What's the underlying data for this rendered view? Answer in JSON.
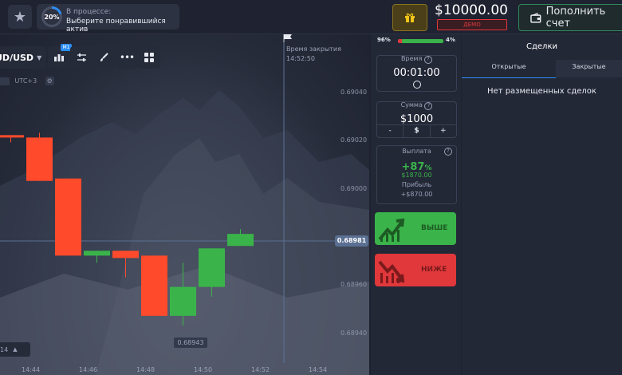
{
  "topbar": {
    "progress_percent": "20%",
    "progress_title": "В процессе:",
    "progress_subtitle": "Выберите понравившийся актив",
    "balance": "$10000.00",
    "account_type": "ДЕМО",
    "topup_label": "Пополнить счет",
    "colors": {
      "accent_blue": "#2d8ef5",
      "demo_red": "#e0383b",
      "topup_border": "#2f8a5a",
      "gift_gold": "#8a7420"
    }
  },
  "chart": {
    "pair": "UD/USD",
    "timeframe_badge": "M1",
    "timezone": "UTC+3",
    "closing_label": "Время закрытия",
    "closing_time": "14:52:50",
    "price_axis": [
      "0.69040",
      "0.69020",
      "0.69000",
      "0.68960",
      "0.68940"
    ],
    "current_price": "0.68981",
    "min_price": "0.68943",
    "time_axis": [
      "14:44",
      "14:46",
      "14:48",
      "14:50",
      "14:52",
      "14:54"
    ],
    "zoom_label": "14",
    "candles": [
      {
        "open": 0.69022,
        "close": 0.69021,
        "high": 0.69022,
        "low": 0.69019,
        "dir": "down"
      },
      {
        "open": 0.69021,
        "close": 0.69003,
        "high": 0.69023,
        "low": 0.69003,
        "dir": "down"
      },
      {
        "open": 0.69004,
        "close": 0.68972,
        "high": 0.69004,
        "low": 0.68972,
        "dir": "down"
      },
      {
        "open": 0.68974,
        "close": 0.68972,
        "high": 0.68974,
        "low": 0.68969,
        "dir": "up"
      },
      {
        "open": 0.68974,
        "close": 0.68971,
        "high": 0.68974,
        "low": 0.68963,
        "dir": "down"
      },
      {
        "open": 0.68972,
        "close": 0.68947,
        "high": 0.68972,
        "low": 0.68947,
        "dir": "down"
      },
      {
        "open": 0.68947,
        "close": 0.68959,
        "high": 0.68969,
        "low": 0.68943,
        "dir": "up"
      },
      {
        "open": 0.68959,
        "close": 0.68975,
        "high": 0.68975,
        "low": 0.68955,
        "dir": "up"
      },
      {
        "open": 0.68976,
        "close": 0.68981,
        "high": 0.68983,
        "low": 0.68976,
        "dir": "up"
      }
    ],
    "colors": {
      "up": "#3ab44a",
      "down": "#ff4a2b",
      "price_line": "#5a6f92"
    }
  },
  "trade": {
    "sell_percent": "96%",
    "buy_percent": "4%",
    "time_label": "Время",
    "time_value": "00:01:00",
    "amount_label": "Сумма",
    "amount_value": "$1000",
    "minus": "-",
    "currency": "$",
    "plus": "+",
    "payout_label": "Выплата",
    "payout_percent": "+87",
    "payout_percent_sign": "%",
    "payout_amount": "$1870.00",
    "profit_label": "Прибыль",
    "profit_amount": "+$870.00",
    "up_label": "ВЫШЕ",
    "down_label": "НИЖЕ",
    "colors": {
      "up": "#3ab44a",
      "down": "#e0383b"
    }
  },
  "deals": {
    "title": "Сделки",
    "tab_open": "Открытые",
    "tab_closed": "Закрытые",
    "empty_text": "Нет размещенных сделок"
  },
  "icons": [
    "star-icon",
    "gift-icon",
    "wallet-icon",
    "chevron-down-icon",
    "candles-icon",
    "settings-sliders-icon",
    "brush-icon",
    "more-icon",
    "grid-icon",
    "gear-icon",
    "flag-icon",
    "help-icon",
    "clock-icon",
    "arrow-up-icon",
    "arrow-down-icon"
  ]
}
